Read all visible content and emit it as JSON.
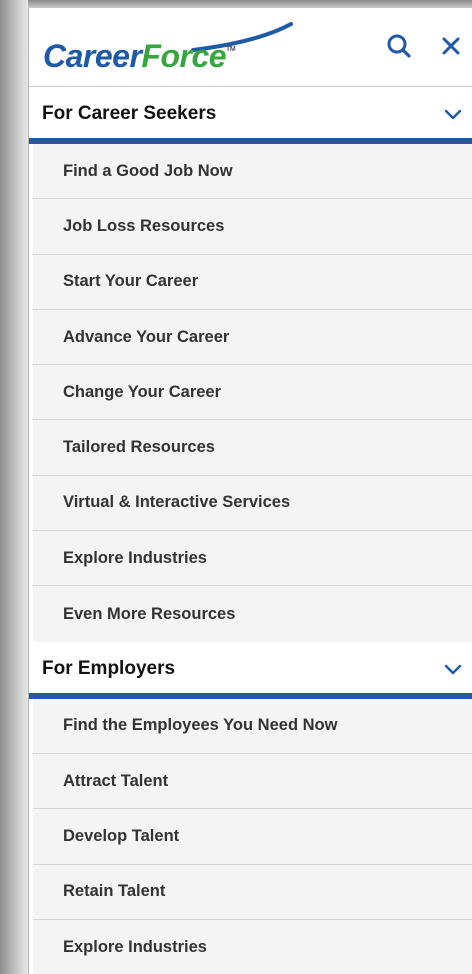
{
  "logo": {
    "career": "Career",
    "force": "Force",
    "tm": "TM"
  },
  "header": {
    "search_icon": "search-icon",
    "close_icon": "close-icon"
  },
  "colors": {
    "brand_blue": "#1f5aa6",
    "brand_green": "#36a63e",
    "item_bg": "#f4f4f4"
  },
  "sections": [
    {
      "title": "For Career Seekers",
      "chevron": "chevron-down-icon",
      "items": [
        {
          "label": "Find a Good Job Now"
        },
        {
          "label": "Job Loss Resources"
        },
        {
          "label": "Start Your Career"
        },
        {
          "label": "Advance Your Career"
        },
        {
          "label": "Change Your Career"
        },
        {
          "label": "Tailored Resources"
        },
        {
          "label": "Virtual & Interactive Services"
        },
        {
          "label": "Explore Industries"
        },
        {
          "label": "Even More Resources"
        }
      ]
    },
    {
      "title": "For Employers",
      "chevron": "chevron-down-icon",
      "items": [
        {
          "label": "Find the Employees You Need Now"
        },
        {
          "label": "Attract Talent"
        },
        {
          "label": "Develop Talent"
        },
        {
          "label": "Retain Talent"
        },
        {
          "label": "Explore Industries"
        }
      ]
    }
  ]
}
